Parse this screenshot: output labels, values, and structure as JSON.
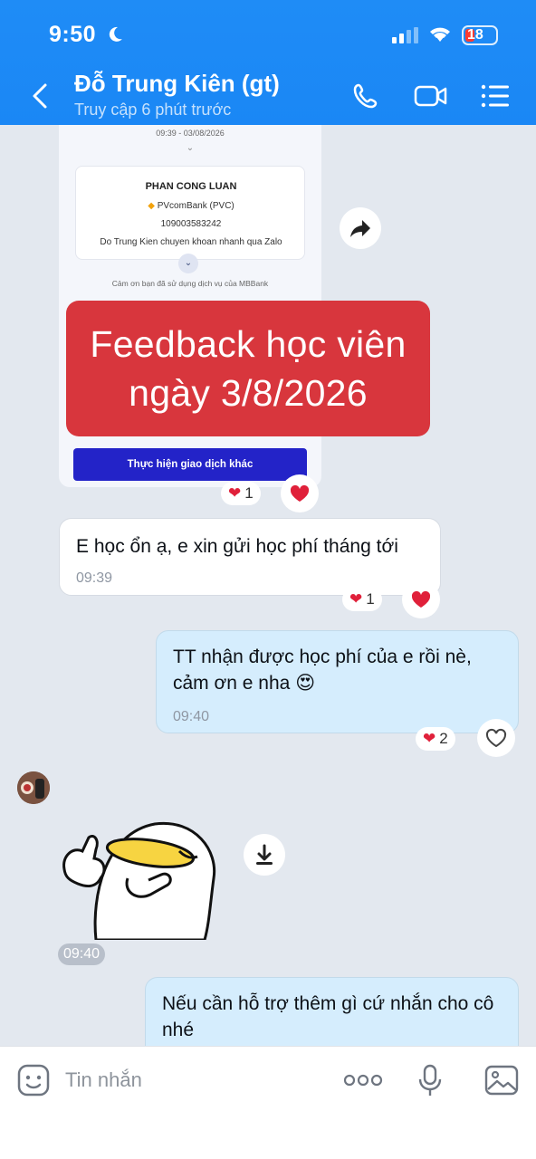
{
  "status_bar": {
    "time": "9:50",
    "battery": "18"
  },
  "header": {
    "contact_name": "Đỗ Trung Kiên (gt)",
    "contact_status": "Truy cập 6 phút trước"
  },
  "receipt": {
    "datetime": "09:39 - 03/08/2026",
    "recipient": "PHAN CONG LUAN",
    "bank": "PVcomBank (PVC)",
    "account": "109003583242",
    "description": "Do Trung Kien chuyen khoan nhanh qua Zalo",
    "thanks": "Cảm ơn bạn đã sử dụng dịch vụ của MBBank",
    "button_label": "Thực hiện giao dịch khác"
  },
  "banner": {
    "line1": "Feedback học viên",
    "line2": "ngày 3/8/2026"
  },
  "reactions": {
    "receipt_count": "1",
    "msg1_count": "1",
    "msg2_count": "2"
  },
  "messages": [
    {
      "from": "contact",
      "text": "E học ổn ạ, e xin gửi học phí tháng tới",
      "time": "09:39"
    },
    {
      "from": "me",
      "text": "TT nhận được học phí của e rồi nè, cảm ơn e nha",
      "emoji": "😍",
      "time": "09:40"
    },
    {
      "from": "contact",
      "type": "sticker",
      "time": "09:40"
    },
    {
      "from": "me",
      "text": "Nếu cần hỗ trợ thêm gì cứ nhắn cho cô nhé"
    }
  ],
  "composer": {
    "placeholder": "Tin nhắn"
  },
  "colors": {
    "header": "#1a87f5",
    "banner": "#d8363d",
    "outgoing": "#d5edfd",
    "heart": "#e0203a"
  }
}
